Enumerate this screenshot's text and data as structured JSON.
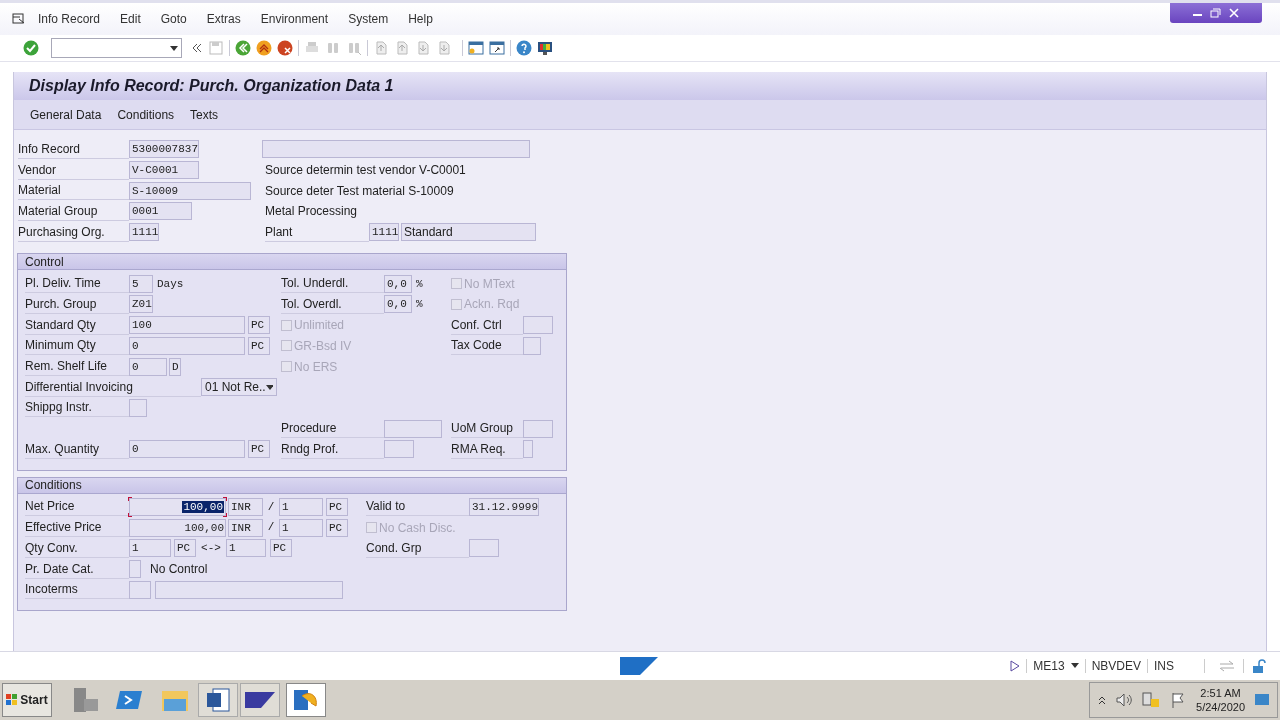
{
  "menu": [
    "Info Record",
    "Edit",
    "Goto",
    "Extras",
    "Environment",
    "System",
    "Help"
  ],
  "title": "Display Info Record: Purch. Organization Data 1",
  "app_toolbar": [
    "General Data",
    "Conditions",
    "Texts"
  ],
  "header": {
    "info_record": {
      "label": "Info Record",
      "value": "5300007837"
    },
    "vendor": {
      "label": "Vendor",
      "value": "V-C0001",
      "description": "Source determin test vendor V-C0001"
    },
    "material": {
      "label": "Material",
      "value": "S-10009",
      "description": "Source deter Test material S-10009"
    },
    "material_group": {
      "label": "Material Group",
      "value": "0001",
      "description": "Metal Processing"
    },
    "purchasing_org": {
      "label": "Purchasing Org."
    },
    "purchasing_org_value": "1111",
    "plant": {
      "label": "Plant",
      "value": "1111",
      "description": "Standard"
    }
  },
  "control": {
    "title": "Control",
    "pl_deliv_time": {
      "label": "Pl. Deliv. Time",
      "value": "5",
      "unit": "Days"
    },
    "purch_group": {
      "label": "Purch. Group",
      "value": "Z01"
    },
    "standard_qty": {
      "label": "Standard Qty",
      "value": "100",
      "unit": "PC"
    },
    "minimum_qty": {
      "label": "Minimum Qty",
      "value": "0",
      "unit": "PC"
    },
    "rem_shelf_life": {
      "label": "Rem. Shelf Life",
      "value": "0",
      "unit": "D"
    },
    "differential_invoicing": {
      "label": "Differential Invoicing",
      "value": "01 Not Re.."
    },
    "shippg_instr": {
      "label": "Shippg Instr."
    },
    "max_quantity": {
      "label": "Max. Quantity",
      "value": "0",
      "unit": "PC"
    },
    "tol_underdl": {
      "label": "Tol. Underdl.",
      "value": "0,0",
      "unit": "%"
    },
    "tol_overdl": {
      "label": "Tol. Overdl.",
      "value": "0,0",
      "unit": "%"
    },
    "unlimited": {
      "label": "Unlimited",
      "checked": false,
      "disabled": true
    },
    "gr_bsd_iv": {
      "label": "GR-Bsd IV",
      "checked": false,
      "disabled": true
    },
    "no_ers": {
      "label": "No ERS",
      "checked": false,
      "disabled": true
    },
    "procedure": {
      "label": "Procedure"
    },
    "rndg_prof": {
      "label": "Rndg Prof."
    },
    "no_mtext": {
      "label": "No MText",
      "checked": false,
      "disabled": true
    },
    "ackn_rqd": {
      "label": "Ackn. Rqd",
      "checked": false,
      "disabled": true
    },
    "conf_ctrl": {
      "label": "Conf. Ctrl"
    },
    "tax_code": {
      "label": "Tax Code"
    },
    "uom_group": {
      "label": "UoM Group"
    },
    "rma_req": {
      "label": "RMA Req."
    }
  },
  "conditions": {
    "title": "Conditions",
    "net_price": {
      "label": "Net Price",
      "value": "100,00",
      "currency": "INR",
      "separator": "/",
      "per": "1",
      "unit": "PC",
      "focused": true
    },
    "effective_price": {
      "label": "Effective Price",
      "value": "100,00",
      "currency": "INR",
      "separator": "/",
      "per": "1",
      "unit": "PC",
      "focused": false
    },
    "valid_to": {
      "label": "Valid to",
      "value": "31.12.9999"
    },
    "no_cash_disc": {
      "label": "No Cash Disc.",
      "checked": false,
      "disabled": true
    },
    "qty_conv": {
      "label": "Qty Conv.",
      "value": "1",
      "unit": "PC",
      "arrow": "<->",
      "value_2": "1",
      "unit_2": "PC"
    },
    "cond_grp": {
      "label": "Cond. Grp"
    },
    "pr_date_cat": {
      "label": "Pr. Date Cat.",
      "description": "No Control"
    },
    "incoterms": {
      "label": "Incoterms"
    }
  },
  "status_bar": {
    "transaction": "ME13",
    "system": "NBVDEV",
    "mode": "INS"
  },
  "taskbar": {
    "start": "Start",
    "time": "2:51 AM",
    "date": "5/24/2020"
  }
}
